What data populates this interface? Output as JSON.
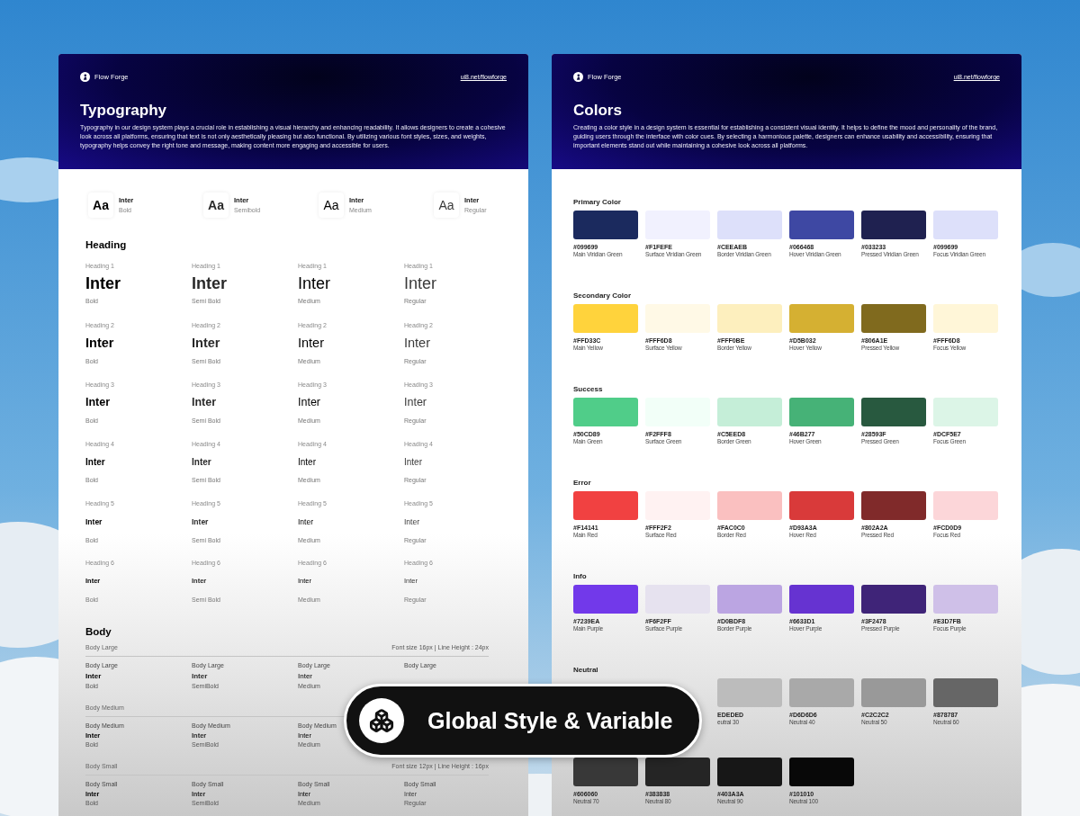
{
  "typography_page": {
    "brand": "Flow Forge",
    "link": "ui8.net/flowforge",
    "title": "Typography",
    "description": "Typography in our design system plays a crucial role in establishing a visual hierarchy and enhancing readability. It allows designers to create a cohesive look across all platforms, ensuring that text is not only aesthetically pleasing but also functional. By utilizing various font styles, sizes, and weights, typography helps convey the right tone and message, making content more engaging and accessible for users.",
    "fonts": [
      {
        "sample": "Aa",
        "name": "Inter",
        "weight": "Bold",
        "kind": "bold"
      },
      {
        "sample": "Aa",
        "name": "Inter",
        "weight": "Semibold",
        "kind": "semibold"
      },
      {
        "sample": "Aa",
        "name": "Inter",
        "weight": "Medium",
        "kind": "medium"
      },
      {
        "sample": "Aa",
        "name": "Inter",
        "weight": "Regular",
        "kind": "regular"
      }
    ],
    "heading_title": "Heading",
    "headings": [
      {
        "cells": [
          {
            "label": "Heading 1",
            "sample": "Inter",
            "weight": "Bold",
            "kind": "bold"
          },
          {
            "label": "Heading 1",
            "sample": "Inter",
            "weight": "Semi Bold",
            "kind": "semibold"
          },
          {
            "label": "Heading 1",
            "sample": "Inter",
            "weight": "Medium",
            "kind": "medium"
          },
          {
            "label": "Heading 1",
            "sample": "Inter",
            "weight": "Regular",
            "kind": "regular"
          }
        ]
      },
      {
        "cells": [
          {
            "label": "Heading 2",
            "sample": "Inter",
            "weight": "Bold",
            "kind": "bold"
          },
          {
            "label": "Heading 2",
            "sample": "Inter",
            "weight": "Semi Bold",
            "kind": "semibold"
          },
          {
            "label": "Heading 2",
            "sample": "Inter",
            "weight": "Medium",
            "kind": "medium"
          },
          {
            "label": "Heading 2",
            "sample": "Inter",
            "weight": "Regular",
            "kind": "regular"
          }
        ]
      },
      {
        "cells": [
          {
            "label": "Heading 3",
            "sample": "Inter",
            "weight": "Bold",
            "kind": "bold"
          },
          {
            "label": "Heading 3",
            "sample": "Inter",
            "weight": "Semi Bold",
            "kind": "semibold"
          },
          {
            "label": "Heading 3",
            "sample": "Inter",
            "weight": "Medium",
            "kind": "medium"
          },
          {
            "label": "Heading 3",
            "sample": "Inter",
            "weight": "Regular",
            "kind": "regular"
          }
        ]
      },
      {
        "cells": [
          {
            "label": "Heading 4",
            "sample": "Inter",
            "weight": "Bold",
            "kind": "bold"
          },
          {
            "label": "Heading 4",
            "sample": "Inter",
            "weight": "Semi Bold",
            "kind": "semibold"
          },
          {
            "label": "Heading 4",
            "sample": "Inter",
            "weight": "Medium",
            "kind": "medium"
          },
          {
            "label": "Heading 4",
            "sample": "Inter",
            "weight": "Regular",
            "kind": "regular"
          }
        ]
      },
      {
        "cells": [
          {
            "label": "Heading 5",
            "sample": "Inter",
            "weight": "Bold",
            "kind": "bold"
          },
          {
            "label": "Heading 5",
            "sample": "Inter",
            "weight": "Semi Bold",
            "kind": "semibold"
          },
          {
            "label": "Heading 5",
            "sample": "Inter",
            "weight": "Medium",
            "kind": "medium"
          },
          {
            "label": "Heading 5",
            "sample": "Inter",
            "weight": "Regular",
            "kind": "regular"
          }
        ]
      },
      {
        "cells": [
          {
            "label": "Heading 6",
            "sample": "Inter",
            "weight": "Bold",
            "kind": "bold"
          },
          {
            "label": "Heading 6",
            "sample": "Inter",
            "weight": "Semi Bold",
            "kind": "semibold"
          },
          {
            "label": "Heading 6",
            "sample": "Inter",
            "weight": "Medium",
            "kind": "medium"
          },
          {
            "label": "Heading 6",
            "sample": "Inter",
            "weight": "Regular",
            "kind": "regular"
          }
        ]
      }
    ],
    "body_title": "Body",
    "body_groups": [
      {
        "name": "Body Large",
        "spec": "Font size 16px | Line Height : 24px",
        "cells": [
          {
            "label": "Body Large",
            "sample": "Inter",
            "weight": "Bold",
            "kind": "bold"
          },
          {
            "label": "Body Large",
            "sample": "Inter",
            "weight": "SemiBold",
            "kind": "semibold"
          },
          {
            "label": "Body Large",
            "sample": "Inter",
            "weight": "Medium",
            "kind": "medium"
          },
          {
            "label": "Body Large"
          }
        ]
      },
      {
        "name": "Body Medium",
        "cells": [
          {
            "label": "Body Medium",
            "sample": "Inter",
            "weight": "Bold",
            "kind": "bold"
          },
          {
            "label": "Body Medium",
            "sample": "Inter",
            "weight": "SemiBold",
            "kind": "semibold"
          },
          {
            "label": "Body Medium",
            "sample": "Inter",
            "weight": "Medium",
            "kind": "medium"
          }
        ]
      },
      {
        "name": "Body Small",
        "spec": "Font size 12px | Line Height : 16px",
        "cells": [
          {
            "label": "Body Small",
            "sample": "Inter",
            "weight": "Bold",
            "kind": "bold"
          },
          {
            "label": "Body Small",
            "sample": "Inter",
            "weight": "SemiBold",
            "kind": "semibold"
          },
          {
            "label": "Body Small",
            "sample": "Inter",
            "weight": "Medium",
            "kind": "medium"
          },
          {
            "label": "Body Small",
            "sample": "Inter",
            "weight": "Regular",
            "kind": "regular"
          }
        ]
      }
    ]
  },
  "colors_page": {
    "brand": "Flow Forge",
    "link": "ui8.net/flowforge",
    "title": "Colors",
    "description": "Creating a color style in a design system is essential for establishing a consistent visual identity. It helps to define the mood and personality of the brand, guiding users through the interface with color cues. By selecting a harmonious palette, designers can enhance usability and accessibility, ensuring that important elements stand out while maintaining a cohesive look across all platforms.",
    "palettes": [
      {
        "name": "Primary Color",
        "kind": "full",
        "swatches": [
          {
            "hex": "#099699",
            "label": "Main Viridian Green",
            "color": "#1b2a5e"
          },
          {
            "hex": "#F1FEFE",
            "label": "Surface Viridian Green",
            "color": "#f1f1fe"
          },
          {
            "hex": "#CEEAEB",
            "label": "Border Viridian Green",
            "color": "#dde0fa"
          },
          {
            "hex": "#066468",
            "label": "Hover Viridian Green",
            "color": "#3e48a3"
          },
          {
            "hex": "#033233",
            "label": "Pressed Viridian Green",
            "color": "#1f2150"
          },
          {
            "hex": "#099699",
            "label": "Focus Viridian Green",
            "color": "#dde0fa"
          }
        ]
      },
      {
        "name": "Secondary Color",
        "kind": "full",
        "swatches": [
          {
            "hex": "#FFD33C",
            "label": "Main Yellow",
            "color": "#ffd33c"
          },
          {
            "hex": "#FFF6D8",
            "label": "Surface Yellow",
            "color": "#fff9e6"
          },
          {
            "hex": "#FFF0BE",
            "label": "Border Yellow",
            "color": "#fdefbe"
          },
          {
            "hex": "#D5B032",
            "label": "Hover Yellow",
            "color": "#d5b032"
          },
          {
            "hex": "#806A1E",
            "label": "Pressed Yellow",
            "color": "#806a1e"
          },
          {
            "hex": "#FFF6D8",
            "label": "Focus Yellow",
            "color": "#fff6d8"
          }
        ]
      },
      {
        "name": "Success",
        "kind": "full",
        "swatches": [
          {
            "hex": "#50CD89",
            "label": "Main Green",
            "color": "#50cd89"
          },
          {
            "hex": "#F2FFF8",
            "label": "Surface Green",
            "color": "#f2fff8"
          },
          {
            "hex": "#C5EED8",
            "label": "Border Green",
            "color": "#c5eed8"
          },
          {
            "hex": "#46B277",
            "label": "Hover Green",
            "color": "#46b277"
          },
          {
            "hex": "#28593F",
            "label": "Pressed Green",
            "color": "#28593f"
          },
          {
            "hex": "#DCF5E7",
            "label": "Focus Green",
            "color": "#dcf5e7"
          }
        ]
      },
      {
        "name": "Error",
        "kind": "full",
        "swatches": [
          {
            "hex": "#F14141",
            "label": "Main Red",
            "color": "#f14141"
          },
          {
            "hex": "#FFF2F2",
            "label": "Surface Red",
            "color": "#fff2f2"
          },
          {
            "hex": "#FAC0C0",
            "label": "Border Red",
            "color": "#fac0c0"
          },
          {
            "hex": "#D93A3A",
            "label": "Hover Red",
            "color": "#d93a3a"
          },
          {
            "hex": "#802A2A",
            "label": "Pressed Red",
            "color": "#802a2a"
          },
          {
            "hex": "#FCD0D9",
            "label": "Focus Red",
            "color": "#fcd6d9"
          }
        ]
      },
      {
        "name": "Info",
        "kind": "full",
        "swatches": [
          {
            "hex": "#7239EA",
            "label": "Main Purple",
            "color": "#7239ea"
          },
          {
            "hex": "#F6F2FF",
            "label": "Surface Purple",
            "color": "#e6e2ef"
          },
          {
            "hex": "#D0BDF8",
            "label": "Border Purple",
            "color": "#bba5e2"
          },
          {
            "hex": "#6633D1",
            "label": "Hover Purple",
            "color": "#6633d1"
          },
          {
            "hex": "#3F2478",
            "label": "Pressed Purple",
            "color": "#3f2478"
          },
          {
            "hex": "#E3D7FB",
            "label": "Focus Purple",
            "color": "#cfc0e8"
          }
        ]
      },
      {
        "name": "Neutral",
        "kind": "partly_covered",
        "swatches": [
          {
            "hex": "EDEDED",
            "label": "eutral 30",
            "color": "#bcbcbc"
          },
          {
            "hex": "#D6D6D6",
            "label": "Neutral 40",
            "color": "#a9a9a9"
          },
          {
            "hex": "#C2C2C2",
            "label": "Neutral 50",
            "color": "#999999"
          },
          {
            "hex": "#878787",
            "label": "Neutral 60",
            "color": "#666666"
          },
          {
            "hex": "#606060",
            "label": "Neutral 70",
            "color": "#383838"
          },
          {
            "hex": "#383838",
            "label": "Neutral 80",
            "color": "#252525"
          },
          {
            "hex": "#403A3A",
            "label": "Neutral 90",
            "color": "#171717"
          },
          {
            "hex": "#101010",
            "label": "Neutral 100",
            "color": "#080808"
          }
        ]
      }
    ]
  },
  "badge": {
    "label": "Global Style & Variable"
  }
}
